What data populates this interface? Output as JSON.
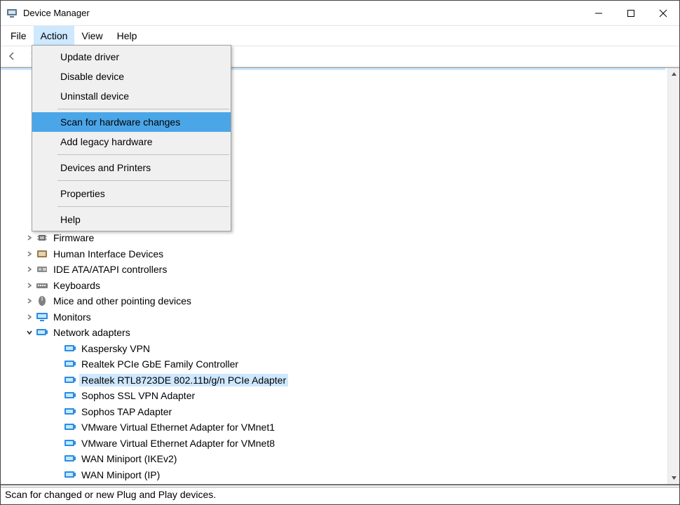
{
  "window": {
    "title": "Device Manager"
  },
  "menubar": {
    "file": "File",
    "action": "Action",
    "view": "View",
    "help": "Help",
    "open_index": 1
  },
  "action_menu": {
    "items": [
      {
        "label": "Update driver"
      },
      {
        "label": "Disable device"
      },
      {
        "label": "Uninstall device"
      },
      "sep",
      {
        "label": "Scan for hardware changes",
        "highlight": true
      },
      {
        "label": "Add legacy hardware"
      },
      "sep",
      {
        "label": "Devices and Printers"
      },
      "sep",
      {
        "label": "Properties"
      },
      "sep",
      {
        "label": "Help"
      }
    ]
  },
  "tree": {
    "visible_categories": [
      {
        "label": "Firmware",
        "icon": "chip"
      },
      {
        "label": "Human Interface Devices",
        "icon": "hid"
      },
      {
        "label": "IDE ATA/ATAPI controllers",
        "icon": "ide"
      },
      {
        "label": "Keyboards",
        "icon": "keyboard"
      },
      {
        "label": "Mice and other pointing devices",
        "icon": "mouse"
      },
      {
        "label": "Monitors",
        "icon": "monitor"
      }
    ],
    "network_label": "Network adapters",
    "network_children": [
      "Kaspersky VPN",
      "Realtek PCIe GbE Family Controller",
      "Realtek RTL8723DE 802.11b/g/n PCIe Adapter",
      "Sophos SSL VPN Adapter",
      "Sophos TAP Adapter",
      "VMware Virtual Ethernet Adapter for VMnet1",
      "VMware Virtual Ethernet Adapter for VMnet8",
      "WAN Miniport (IKEv2)",
      "WAN Miniport (IP)"
    ],
    "selected_child_index": 2
  },
  "statusbar": {
    "text": "Scan for changed or new Plug and Play devices."
  }
}
